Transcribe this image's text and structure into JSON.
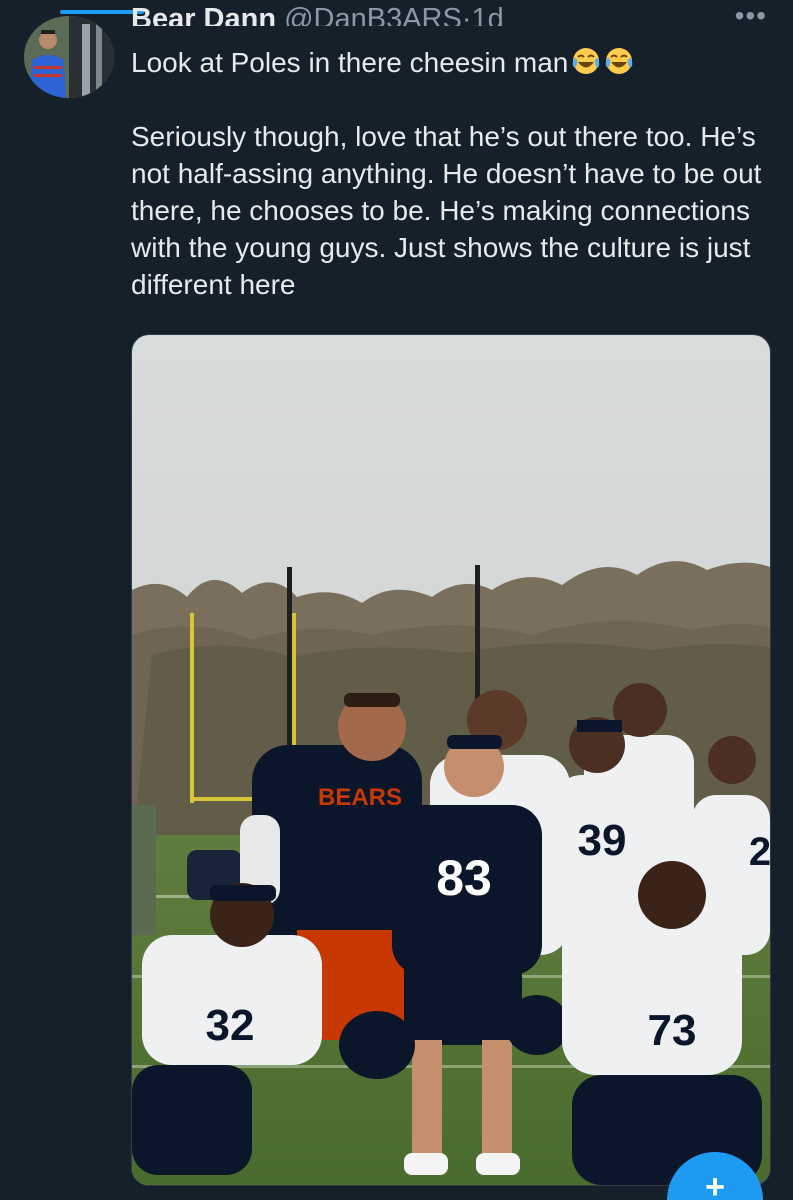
{
  "tweet": {
    "display_name": "Bear Dann",
    "handle": "@DanB3ARS",
    "separator": "·",
    "time": "1d",
    "more_label": "•••",
    "text_line_1": "Look at Poles in there cheesin man",
    "text_paragraph_2": "Seriously though, love that he’s out there too. He’s not half-assing anything. He doesn’t have to be out there, he chooses to be. He’s making connections with the young guys. Just shows the culture is just different here",
    "emoji": [
      "face-with-tears-of-joy",
      "face-with-tears-of-joy"
    ]
  },
  "photo": {
    "hoodie_text": "BEARS",
    "jersey_numbers": [
      "83",
      "39",
      "32",
      "73",
      "2"
    ]
  },
  "compose_button": {
    "label": "+"
  },
  "colors": {
    "background": "#15202b",
    "text": "#e7e9ea",
    "secondary_text": "#8b98a5",
    "accent": "#1d9bf0",
    "bears_navy": "#0b162a",
    "bears_orange": "#c83803"
  }
}
